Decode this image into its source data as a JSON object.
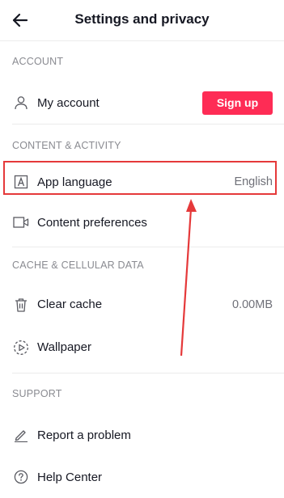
{
  "header": {
    "title": "Settings and privacy",
    "back_icon": "arrow-left-icon"
  },
  "sections": {
    "account": {
      "title": "ACCOUNT",
      "my_account": {
        "label": "My account",
        "button": "Sign up",
        "icon": "person-icon"
      }
    },
    "content_activity": {
      "title": "CONTENT & ACTIVITY",
      "app_language": {
        "label": "App language",
        "value": "English",
        "icon": "letter-a-icon"
      },
      "content_preferences": {
        "label": "Content preferences",
        "icon": "video-camera-icon"
      }
    },
    "cache": {
      "title": "CACHE & CELLULAR DATA",
      "clear_cache": {
        "label": "Clear cache",
        "value": "0.00MB",
        "icon": "trash-icon"
      },
      "wallpaper": {
        "label": "Wallpaper",
        "icon": "play-circle-icon"
      }
    },
    "support": {
      "title": "SUPPORT",
      "report": {
        "label": "Report a problem",
        "icon": "pencil-icon"
      },
      "help": {
        "label": "Help Center",
        "icon": "question-circle-icon"
      }
    }
  },
  "colors": {
    "accent": "#fe2c55",
    "highlight": "#e5393a",
    "muted": "#8a8b91"
  }
}
